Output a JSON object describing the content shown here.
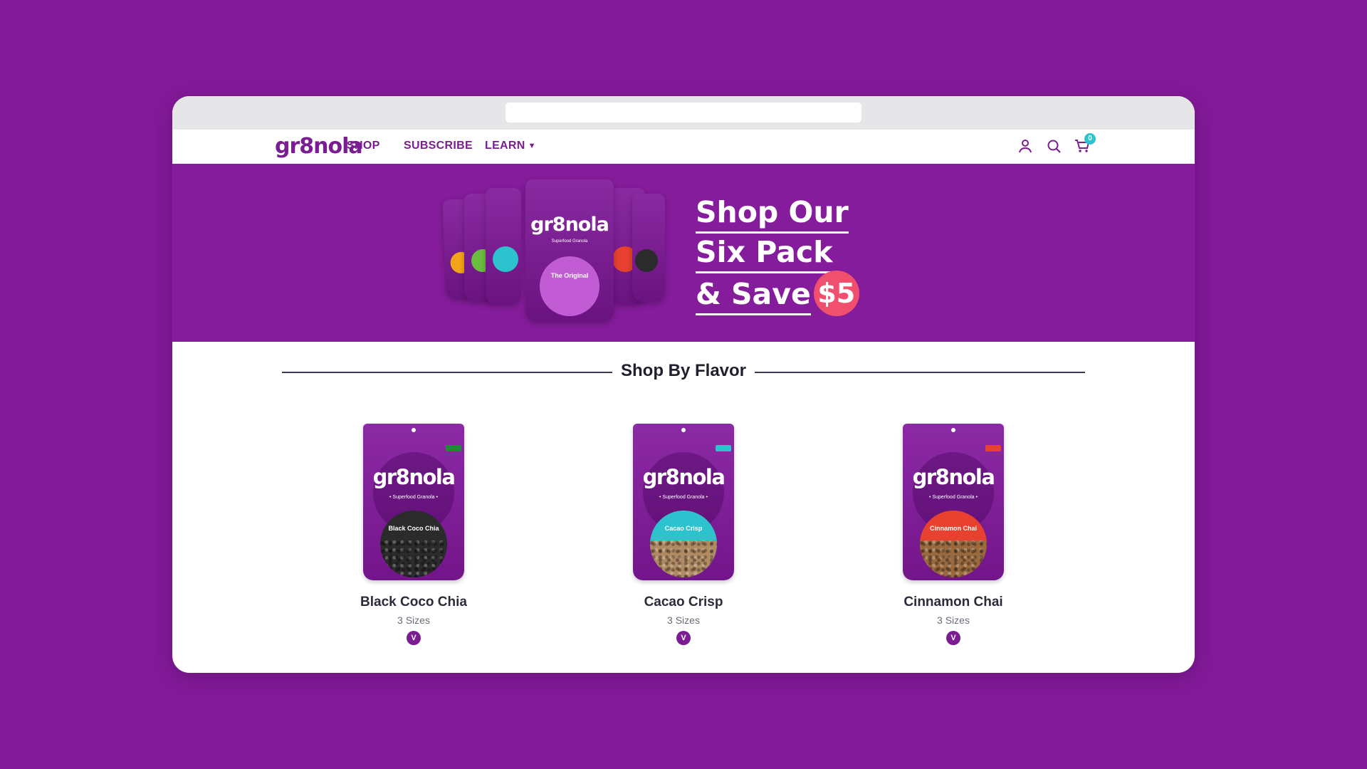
{
  "brand": {
    "logo_text": "gr8nola"
  },
  "nav": {
    "links": [
      {
        "label": "SHOP"
      },
      {
        "label": "SUBSCRIBE"
      },
      {
        "label": "LEARN"
      }
    ],
    "cart_count": "0"
  },
  "hero": {
    "line1": "Shop Our",
    "line2": "Six Pack",
    "line3": "& Save",
    "badge": "$5",
    "pack_brand": "gr8nola",
    "pack_center_label": "The Original",
    "pack_center_sub": "Superfood Granola"
  },
  "section": {
    "title": "Shop By Flavor"
  },
  "products": [
    {
      "name": "Black Coco Chia",
      "sizes": "3 Sizes",
      "badge": "V",
      "bag_brand": "gr8nola",
      "bag_sub": "• Superfood Granola •",
      "bag_label": "Black Coco Chia",
      "disc_color": "#2b2b2b",
      "tag_color": "#1f8a3a"
    },
    {
      "name": "Cacao Crisp",
      "sizes": "3 Sizes",
      "badge": "V",
      "bag_brand": "gr8nola",
      "bag_sub": "• Superfood Granola •",
      "bag_label": "Cacao Crisp",
      "disc_color": "#2cc3cf",
      "tag_color": "#2cc3cf"
    },
    {
      "name": "Cinnamon Chai",
      "sizes": "3 Sizes",
      "badge": "V",
      "bag_brand": "gr8nola",
      "bag_sub": "• Superfood Granola •",
      "bag_label": "Cinnamon Chai",
      "disc_color": "#e8412f",
      "tag_color": "#e8412f"
    }
  ],
  "colors": {
    "page_bg": "#821998",
    "brand_purple": "#7a1d92",
    "hero_bg": "#851c9b",
    "accent_pink": "#f0506e",
    "cart_badge": "#2fc3cf"
  }
}
